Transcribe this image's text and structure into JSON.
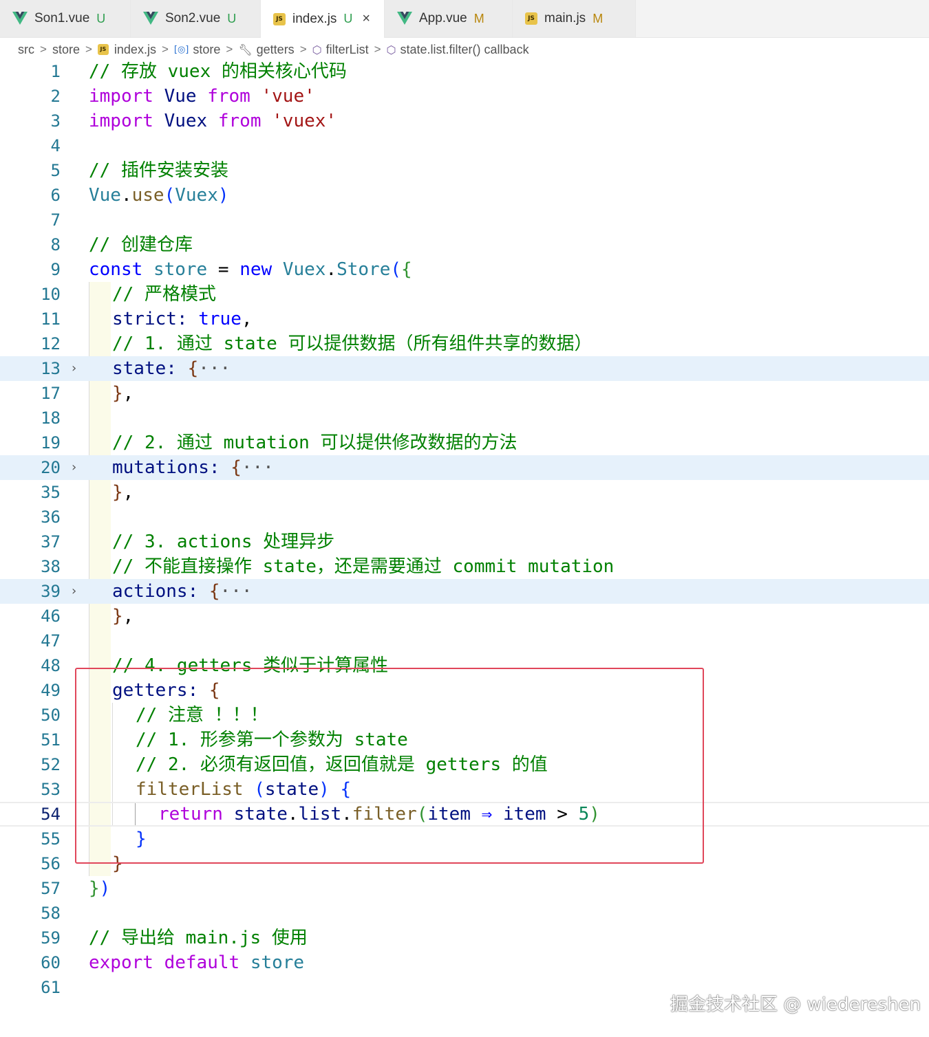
{
  "tabs": [
    {
      "label": "Son1.vue",
      "status": "U",
      "type": "vue"
    },
    {
      "label": "Son2.vue",
      "status": "U",
      "type": "vue"
    },
    {
      "label": "index.js",
      "status": "U",
      "type": "js",
      "active": true
    },
    {
      "label": "App.vue",
      "status": "M",
      "type": "vue"
    },
    {
      "label": "main.js",
      "status": "M",
      "type": "js"
    }
  ],
  "js_icon_text": "JS",
  "close_symbol": "×",
  "breadcrumb": [
    "src",
    "store",
    "index.js",
    "store",
    "getters",
    "filterList",
    "state.list.filter() callback"
  ],
  "code": {
    "l1": "// 存放 vuex 的相关核心代码",
    "kw_import": "import",
    "kw_from": "from",
    "vue_id": "Vue",
    "vuex_id": "Vuex",
    "str_vue": "'vue'",
    "str_vuex": "'vuex'",
    "l5": "// 插件安装安装",
    "use": "use",
    "l8": "// 创建仓库",
    "kw_const": "const",
    "store_id": "store",
    "kw_new": "new",
    "store_cls": "Store",
    "l10": "// 严格模式",
    "strict": "strict",
    "kw_true": "true",
    "l12": "// 1. 通过 state 可以提供数据（所有组件共享的数据）",
    "state_prop": "state",
    "l19": "// 2. 通过 mutation 可以提供修改数据的方法",
    "mutations": "mutations",
    "l37": "// 3. actions 处理异步",
    "l38": "// 不能直接操作 state，还是需要通过 commit mutation",
    "actions": "actions",
    "l48": "// 4. getters 类似于计算属性",
    "getters": "getters",
    "l50": "// 注意 ！！！",
    "l51": "// 1. 形参第一个参数为 state",
    "l52": "// 2. 必须有返回值，返回值就是 getters 的值",
    "filterList": "filterList",
    "state_param": "state",
    "kw_return": "return",
    "list": "list",
    "filter": "filter",
    "item": "item",
    "arrow": "⇒",
    "gt": ">",
    "five": "5",
    "l59": "// 导出给 main.js 使用",
    "kw_export": "export",
    "kw_default": "default",
    "ellipsis": "···"
  },
  "line_numbers": [
    "1",
    "2",
    "3",
    "4",
    "5",
    "6",
    "7",
    "8",
    "9",
    "10",
    "11",
    "12",
    "13",
    "17",
    "18",
    "19",
    "20",
    "35",
    "36",
    "37",
    "38",
    "39",
    "46",
    "47",
    "48",
    "49",
    "50",
    "51",
    "52",
    "53",
    "54",
    "55",
    "56",
    "57",
    "58",
    "59",
    "60",
    "61"
  ],
  "active_line": "54",
  "folded_lines": [
    "13",
    "20",
    "39"
  ],
  "watermark": "掘金技术社区 @ wiedereshen",
  "colors": {
    "highlight_box": "#e0465a",
    "comment": "#008000",
    "keyword": "#af00db",
    "string": "#a31515"
  }
}
